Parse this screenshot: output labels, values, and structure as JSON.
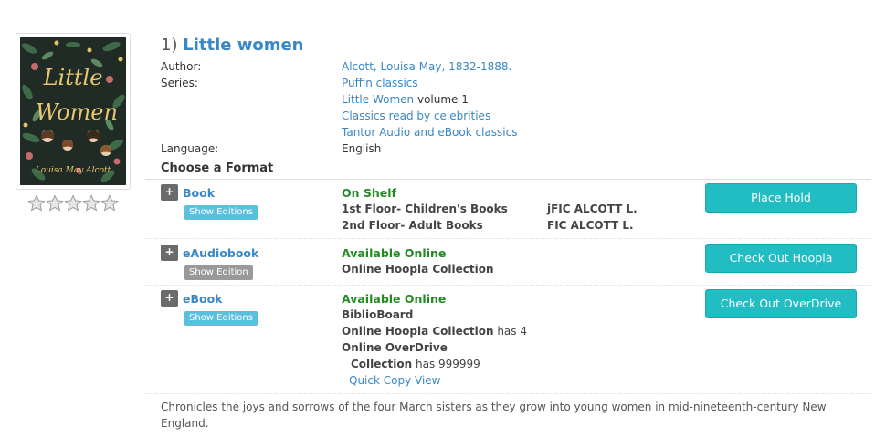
{
  "result": {
    "number": "1)",
    "title": "Little women",
    "cover_text": {
      "line1": "Little",
      "line2": "Women",
      "author": "Louisa May Alcott"
    },
    "rating": {
      "stars_filled": 0,
      "stars_total": 5
    },
    "author_label": "Author:",
    "author": "Alcott, Louisa May, 1832-1888.",
    "series_label": "Series:",
    "series": [
      {
        "name": "Puffin classics",
        "suffix": ""
      },
      {
        "name": "Little Women",
        "suffix": " volume 1"
      },
      {
        "name": "Classics read by celebrities",
        "suffix": ""
      },
      {
        "name": "Tantor Audio and eBook classics",
        "suffix": ""
      }
    ],
    "language_label": "Language:",
    "language": "English",
    "choose_format": "Choose a Format",
    "formats": [
      {
        "name": "Book",
        "editions_label": "Show Editions",
        "status": "On Shelf",
        "locations": [
          {
            "place": "1st Floor- Children's Books",
            "call": "jFIC ALCOTT L."
          },
          {
            "place": "2nd Floor- Adult Books",
            "call": "FIC ALCOTT L."
          }
        ],
        "action": "Place Hold"
      },
      {
        "name": "eAudiobook",
        "editions_label": "Show Edition",
        "status": "Available Online",
        "locations": [
          {
            "place": "Online Hoopla Collection"
          }
        ],
        "action": "Check Out Hoopla"
      },
      {
        "name": "eBook",
        "editions_label": "Show Editions",
        "status": "Available Online",
        "lines": [
          {
            "text": "BiblioBoard",
            "extra": ""
          },
          {
            "text": "Online Hoopla Collection",
            "extra": " has 4"
          },
          {
            "text": "Online OverDrive",
            "extra": ""
          },
          {
            "text": "Collection",
            "extra": " has 999999"
          }
        ],
        "quick_copy": "Quick Copy View",
        "action": "Check Out OverDrive"
      }
    ],
    "plus_symbol": "+",
    "description": "Chronicles the joys and sorrows of the four March sisters as they grow into young women in mid-nineteenth-century New England."
  },
  "colors": {
    "link": "#3a87c5",
    "available": "#228b22",
    "action_button": "#22bcc3",
    "editions_blue": "#5bc0de",
    "editions_gray": "#999999"
  }
}
